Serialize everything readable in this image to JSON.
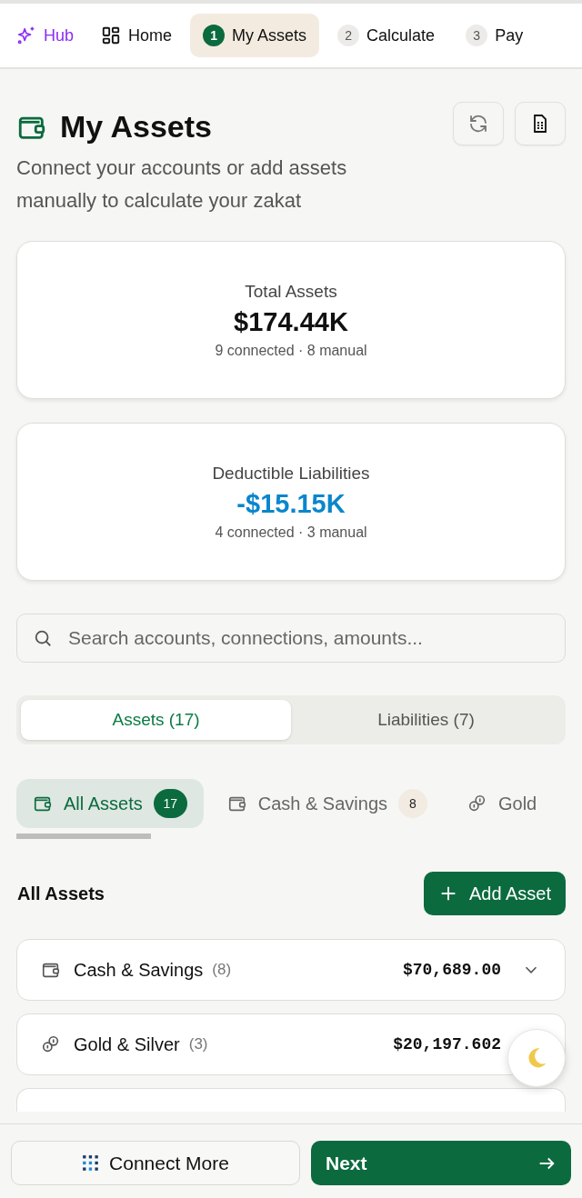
{
  "nav": [
    {
      "kind": "hub",
      "label": "Hub",
      "selected": false
    },
    {
      "kind": "home",
      "label": "Home",
      "selected": false
    },
    {
      "kind": "step",
      "number": "1",
      "label": "My Assets",
      "selected": true
    },
    {
      "kind": "step",
      "number": "2",
      "label": "Calculate",
      "selected": false
    },
    {
      "kind": "step",
      "number": "3",
      "label": "Pay",
      "selected": false
    }
  ],
  "header": {
    "title": "My Assets",
    "subtitle": "Connect your accounts or add assets manually to calculate your zakat"
  },
  "summary": [
    {
      "kind": "assets",
      "label": "Total Assets",
      "value": "$174.44K",
      "detail": "9 connected · 8 manual"
    },
    {
      "kind": "liabilities",
      "label": "Deductible Liabilities",
      "value": "-$15.15K",
      "detail": "4 connected · 3 manual"
    }
  ],
  "search": {
    "placeholder": "Search accounts, connections, amounts..."
  },
  "segments": [
    {
      "label": "Assets (17)",
      "selected": true
    },
    {
      "label": "Liabilities (7)",
      "selected": false
    }
  ],
  "chips": [
    {
      "kind": "wallet",
      "label": "All Assets",
      "count": "17",
      "selected": true
    },
    {
      "kind": "wallet",
      "label": "Cash & Savings",
      "count": "8",
      "selected": false
    },
    {
      "kind": "coins",
      "label": "Gold",
      "selected": false
    }
  ],
  "section": {
    "title": "All Assets",
    "button": "Add Asset"
  },
  "rows": [
    {
      "kind": "wallet",
      "name": "Cash & Savings",
      "count": "(8)",
      "amount": "$70,689.00",
      "expandable": true
    },
    {
      "kind": "coins",
      "name": "Gold & Silver",
      "count": "(3)",
      "amount": "$20,197.602"
    },
    {
      "kind": "blank"
    }
  ],
  "footer": {
    "secondary": "Connect More",
    "primary": "Next"
  }
}
